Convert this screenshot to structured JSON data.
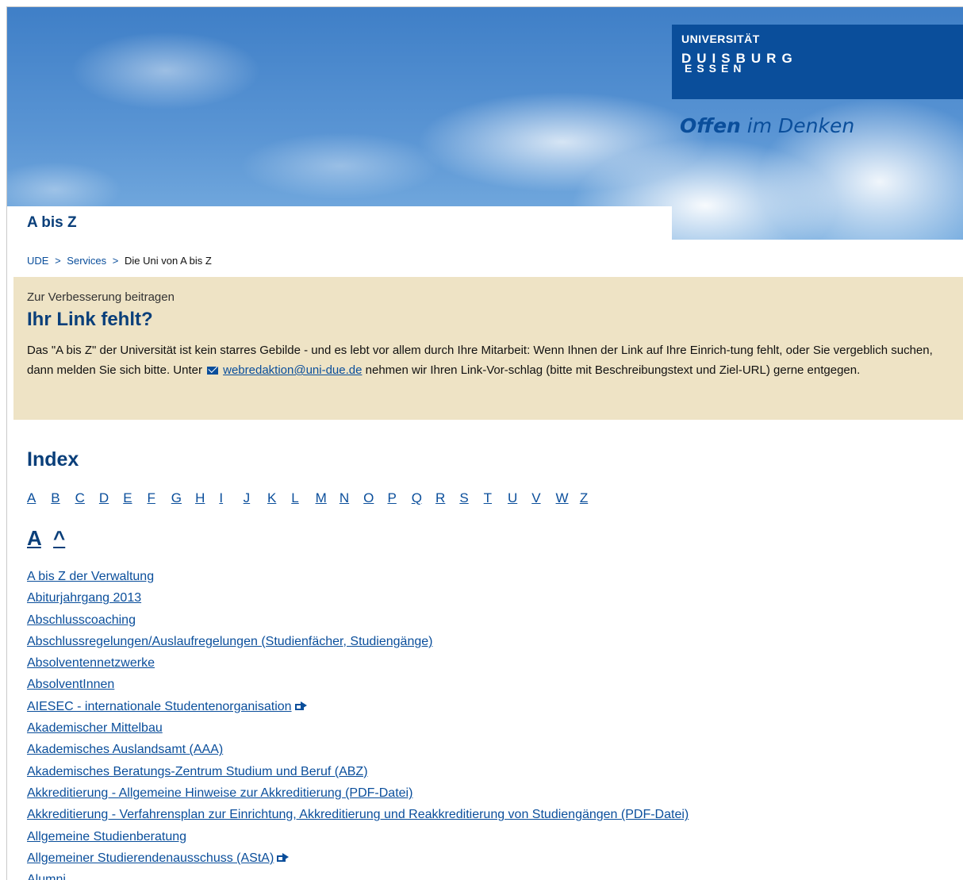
{
  "header": {
    "logo_university": "UNIVERSITÄT",
    "logo_duisburg": "DUISBURG",
    "logo_essen": "ESSEN",
    "slogan_bold": "Offen",
    "slogan_rest": " im Denken",
    "brand_color": "#0a4e9b"
  },
  "page": {
    "title": "A bis Z"
  },
  "breadcrumb": {
    "items": [
      "UDE",
      "Services",
      "Die Uni von A bis Z"
    ],
    "separator": ">"
  },
  "notice": {
    "kicker": "Zur Verbesserung beitragen",
    "title": "Ihr Link fehlt?",
    "text_before": "Das \"A bis Z\" der Universität ist kein starres Gebilde - und es lebt vor allem durch Ihre Mitarbeit: Wenn Ihnen der Link auf Ihre Einrich-tung fehlt, oder Sie vergeblich suchen, dann melden Sie sich bitte. Unter ",
    "email": "webredaktion@uni-due.de",
    "text_after": " nehmen wir Ihren Link-Vor-schlag (bitte mit Beschreibungstext und Ziel-URL) gerne entgegen.",
    "background": "#eee3c5"
  },
  "index": {
    "title": "Index",
    "letters": [
      "A",
      "B",
      "C",
      "D",
      "E",
      "F",
      "G",
      "H",
      "I",
      "J",
      "K",
      "L",
      "M",
      "N",
      "O",
      "P",
      "Q",
      "R",
      "S",
      "T",
      "U",
      "V",
      "W",
      "Z"
    ]
  },
  "section": {
    "letter": "A",
    "caret": "^",
    "links": [
      {
        "label": "A bis Z der Verwaltung",
        "external": false
      },
      {
        "label": "Abiturjahrgang 2013",
        "external": false
      },
      {
        "label": "Abschlusscoaching",
        "external": false
      },
      {
        "label": "Abschlussregelungen/Auslaufregelungen (Studienfächer, Studiengänge)",
        "external": false
      },
      {
        "label": "Absolventennetzwerke",
        "external": false
      },
      {
        "label": "AbsolventInnen",
        "external": false
      },
      {
        "label": "AIESEC - internationale Studentenorganisation",
        "external": true
      },
      {
        "label": "Akademischer Mittelbau",
        "external": false
      },
      {
        "label": "Akademisches Auslandsamt (AAA)",
        "external": false
      },
      {
        "label": "Akademisches Beratungs-Zentrum Studium und Beruf (ABZ)",
        "external": false
      },
      {
        "label": "Akkreditierung - Allgemeine Hinweise zur Akkreditierung (PDF-Datei)",
        "external": false
      },
      {
        "label": "Akkreditierung - Verfahrensplan zur Einrichtung, Akkreditierung und Reakkreditierung von Studiengängen (PDF-Datei)",
        "external": false
      },
      {
        "label": "Allgemeine Studienberatung",
        "external": false
      },
      {
        "label": "Allgemeiner Studierendenausschuss (AStA)",
        "external": true
      },
      {
        "label": "Alumni",
        "external": false
      }
    ]
  }
}
